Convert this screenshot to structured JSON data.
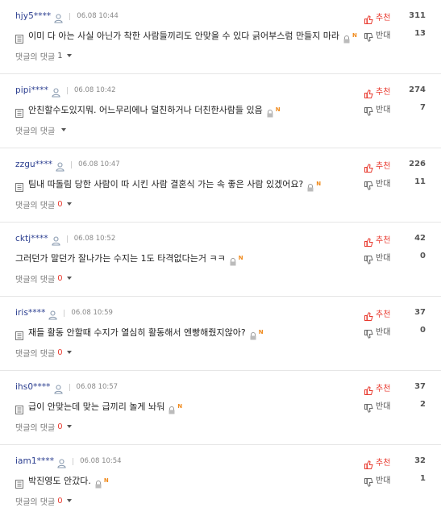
{
  "labels": {
    "replies": "댓글의 댓글",
    "recommend": "추천",
    "oppose": "반대",
    "new_badge": "N"
  },
  "colors": {
    "username": "#2a3d8f",
    "recommend": "#e83a2f",
    "oppose": "#555555",
    "reply_count_zero": "#e83a2f",
    "new_badge": "#f08a1c"
  },
  "icons": {
    "user": "user-icon",
    "comment": "document-icon",
    "report": "lock-icon",
    "recommend": "thumbs-up-icon",
    "oppose": "thumbs-down-icon",
    "expand": "caret-down-icon"
  },
  "comments": [
    {
      "user": "hjy5****",
      "time": "06.08 10:44",
      "text": "이미 다 아는 사실 아닌가 착한 사람들끼리도 안맞을 수 있다 긁어부스럼 만들지 마라",
      "replies": "1",
      "up": "311",
      "down": "13"
    },
    {
      "user": "pipi****",
      "time": "06.08 10:42",
      "text": "안친할수도있지뭐. 어느무리에나 덜친하거나 더친한사람들 있음",
      "replies": "",
      "up": "274",
      "down": "7"
    },
    {
      "user": "zzgu****",
      "time": "06.08 10:47",
      "text": "팀내 따돌림 당한 사람이 따 시킨 사람 결혼식 가는 속 좋은 사람 있겠어요?",
      "replies": "0",
      "up": "226",
      "down": "11"
    },
    {
      "user": "cktj****",
      "time": "06.08 10:52",
      "text": "그러던가 말던가 잘나가는 수지는 1도 타격없다는거 ㅋㅋ",
      "replies": "0",
      "up": "42",
      "down": "0"
    },
    {
      "user": "iris****",
      "time": "06.08 10:59",
      "text": "재들 활동 안할때 수지가 열심히 활동해서 엔빵해줬지않아?",
      "replies": "0",
      "up": "37",
      "down": "0"
    },
    {
      "user": "ihs0****",
      "time": "06.08 10:57",
      "text": "급이 안맞는데 맞는 급끼리 놀게 놔둬",
      "replies": "0",
      "up": "37",
      "down": "2"
    },
    {
      "user": "iam1****",
      "time": "06.08 10:54",
      "text": "박진영도 안갔다.",
      "replies": "0",
      "up": "32",
      "down": "1"
    }
  ]
}
